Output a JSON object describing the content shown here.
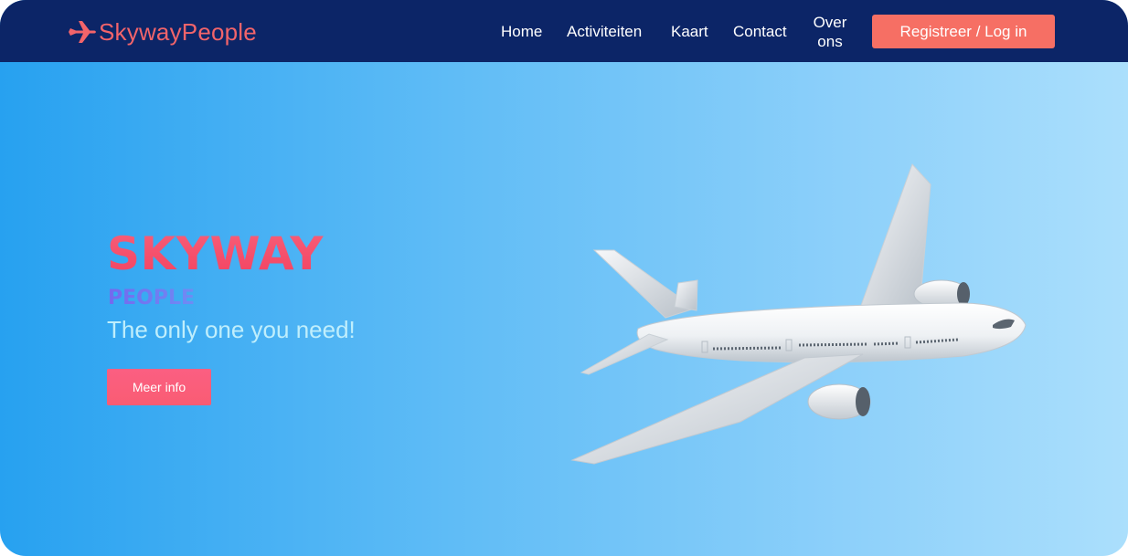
{
  "brand": {
    "name": "SkywayPeople",
    "icon": "airplane-icon",
    "color": "#f2646a"
  },
  "nav": {
    "home": "Home",
    "activiteiten": "Activiteiten",
    "kaart": "Kaart",
    "contact": "Contact",
    "over_ons": "Over ons",
    "register_login": "Registreer / Log in"
  },
  "hero": {
    "title": "SKYWAY",
    "subtitle": "PEOPLE",
    "tagline": "The only one you need!",
    "button_label": "Meer info",
    "illustration": "passenger-jet-illustration"
  },
  "colors": {
    "navbar_bg": "#0c2567",
    "accent": "#f66f64",
    "title_pink": "#f3415f",
    "subtitle_purple": "#7468ee",
    "hero_gradient_start": "#27a1f0",
    "hero_gradient_end": "#abdffc"
  }
}
